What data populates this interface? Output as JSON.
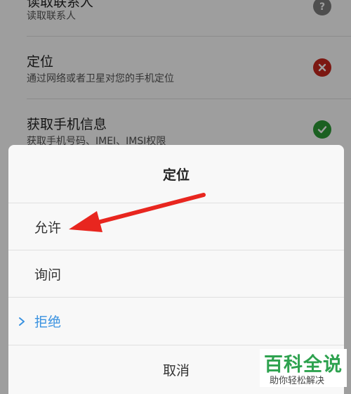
{
  "permissions": [
    {
      "title": "读取联系人",
      "desc": "读取联系人",
      "status": "ask-icon"
    },
    {
      "title": "定位",
      "desc": "通过网络或者卫星对您的手机定位",
      "status": "deny-icon"
    },
    {
      "title": "获取手机信息",
      "desc": "获取手机号码、IMEI、IMSI权限",
      "status": "allow-icon"
    }
  ],
  "dialog": {
    "title": "定位",
    "options": [
      {
        "label": "允许",
        "selected": false
      },
      {
        "label": "询问",
        "selected": false
      },
      {
        "label": "拒绝",
        "selected": true
      }
    ],
    "cancel_label": "取消"
  },
  "colors": {
    "ask": "#7f7f7f",
    "deny": "#c8281e",
    "allow": "#2d9b36",
    "selected_text": "#3a92e0",
    "arrow": "#e8261f",
    "watermark": "#2ea24f"
  },
  "watermark": {
    "main": "百科全说",
    "sub": "助你轻松解决"
  }
}
